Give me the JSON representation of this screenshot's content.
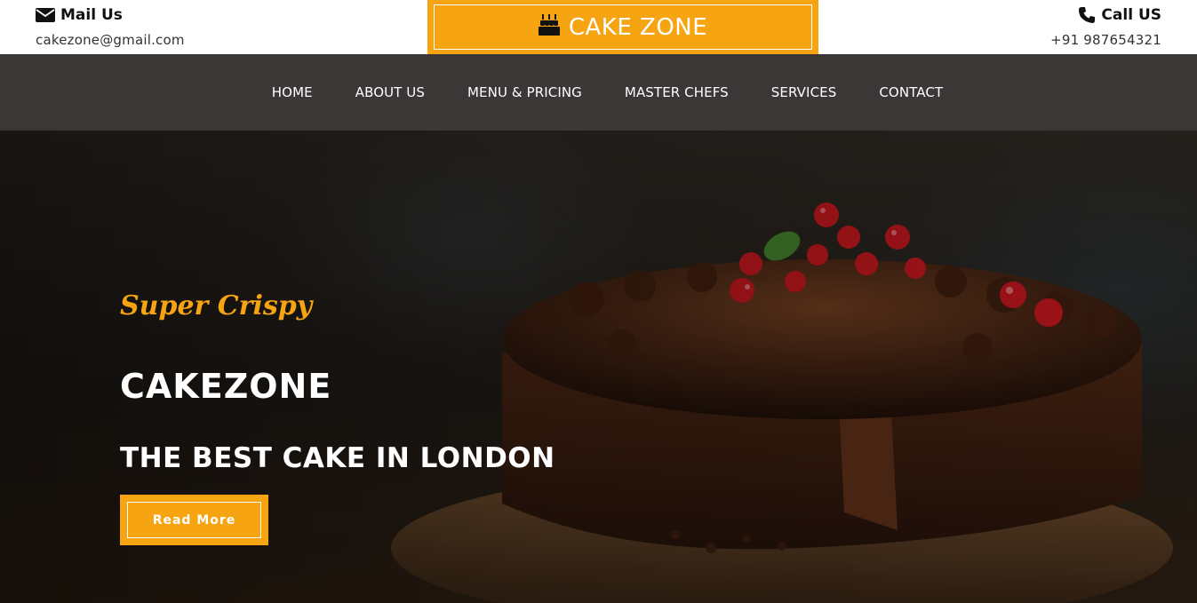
{
  "header": {
    "mail": {
      "title": "Mail Us",
      "value": "cakezone@gmail.com",
      "icon": "envelope-icon"
    },
    "call": {
      "title": "Call US",
      "value": "+91 987654321",
      "icon": "phone-icon"
    },
    "brand": {
      "name": "CAKE ZONE",
      "icon": "birthday-cake-icon"
    }
  },
  "nav": {
    "items": [
      {
        "label": "HOME"
      },
      {
        "label": "ABOUT US"
      },
      {
        "label": "MENU & PRICING"
      },
      {
        "label": "MASTER CHEFS"
      },
      {
        "label": "SERVICES"
      },
      {
        "label": "CONTACT"
      }
    ]
  },
  "hero": {
    "tagline": "Super Crispy",
    "title": "CAKEZONE",
    "subtitle": "THE BEST CAKE IN LONDON",
    "button_label": "Read More"
  },
  "colors": {
    "accent": "#F6A411",
    "nav_bg": "#3a3736",
    "text_dark": "#111111"
  }
}
